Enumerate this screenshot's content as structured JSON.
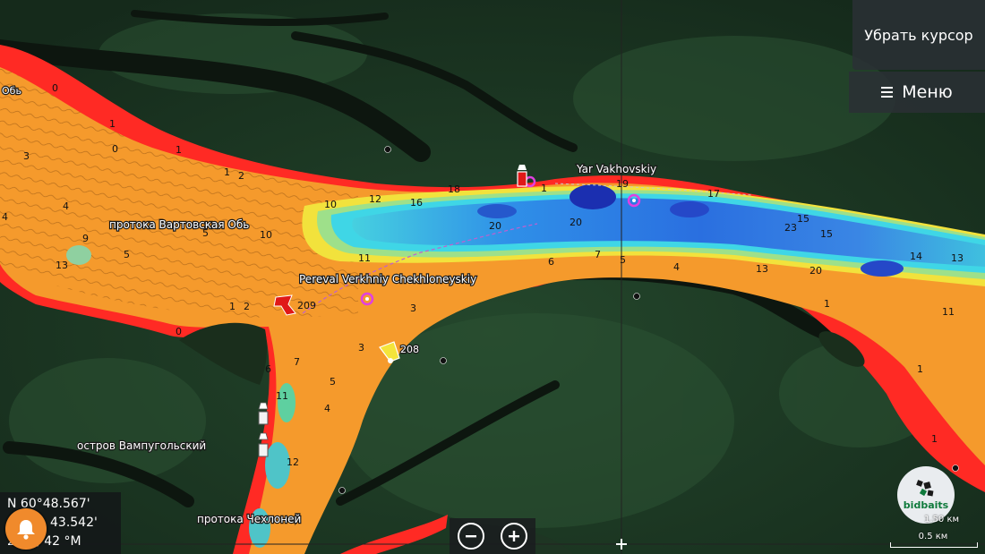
{
  "controls": {
    "remove_cursor": "Убрать курсор",
    "menu": "Меню"
  },
  "cursor_readout": {
    "lat": "N 60°48.567'",
    "lon": "43.542'",
    "info": "2 км, 42 °M"
  },
  "places": {
    "ob": "Обь",
    "vartovskaya": "протока Вартовская Обь",
    "pereval": "Pereval Verkhniy Chekhloneyskiy",
    "yar": "Yar Vakhovskiy",
    "vampugolskiy": "остров Вампугольский",
    "chekhloney": "протока Чехлоней"
  },
  "buoys": {
    "b209": "209",
    "b208": "208"
  },
  "depth_labels": [
    {
      "t": "0",
      "id": "d1"
    },
    {
      "t": "3",
      "id": "d2"
    },
    {
      "t": "4",
      "id": "d3"
    },
    {
      "t": "0",
      "id": "d4"
    },
    {
      "t": "1",
      "id": "d5"
    },
    {
      "t": "1",
      "id": "d6"
    },
    {
      "t": "2",
      "id": "d7"
    },
    {
      "t": "4",
      "id": "d8"
    },
    {
      "t": "5",
      "id": "d9"
    },
    {
      "t": "9",
      "id": "d10"
    },
    {
      "t": "5",
      "id": "d11"
    },
    {
      "t": "10",
      "id": "d12"
    },
    {
      "t": "12",
      "id": "d13"
    },
    {
      "t": "16",
      "id": "d14"
    },
    {
      "t": "10",
      "id": "d15"
    },
    {
      "t": "20",
      "id": "d16"
    },
    {
      "t": "20",
      "id": "d17"
    },
    {
      "t": "18",
      "id": "d18"
    },
    {
      "t": "19",
      "id": "d19"
    },
    {
      "t": "17",
      "id": "d20"
    },
    {
      "t": "15",
      "id": "d21"
    },
    {
      "t": "23",
      "id": "d22"
    },
    {
      "t": "15",
      "id": "d23"
    },
    {
      "t": "20",
      "id": "d24"
    },
    {
      "t": "13",
      "id": "d25"
    },
    {
      "t": "14",
      "id": "d26"
    },
    {
      "t": "13",
      "id": "d27"
    },
    {
      "t": "11",
      "id": "d28"
    },
    {
      "t": "11",
      "id": "d29"
    },
    {
      "t": "6",
      "id": "d30"
    },
    {
      "t": "7",
      "id": "d31"
    },
    {
      "t": "5",
      "id": "d32"
    },
    {
      "t": "4",
      "id": "d33"
    },
    {
      "t": "3",
      "id": "d34"
    },
    {
      "t": "1",
      "id": "d35"
    },
    {
      "t": "1",
      "id": "d36"
    },
    {
      "t": "0",
      "id": "d37"
    },
    {
      "t": "3",
      "id": "d38"
    },
    {
      "t": "6",
      "id": "d39"
    },
    {
      "t": "7",
      "id": "d40"
    },
    {
      "t": "5",
      "id": "d41"
    },
    {
      "t": "4",
      "id": "d42"
    },
    {
      "t": "11",
      "id": "d43"
    },
    {
      "t": "12",
      "id": "d44"
    },
    {
      "t": "1",
      "id": "d45"
    },
    {
      "t": "1",
      "id": "d46"
    },
    {
      "t": "1",
      "id": "d47"
    },
    {
      "t": "2",
      "id": "d48"
    },
    {
      "t": "13",
      "id": "d49"
    },
    {
      "t": "1",
      "id": "d50"
    }
  ],
  "scale": {
    "small": "1.50 км",
    "main": "0.5 км"
  },
  "logo": {
    "text": "bidbaits"
  },
  "colors": {
    "land": "#1d3a25",
    "shallow_red": "#ff2a24",
    "orange": "#f59a2c",
    "yellow": "#f2e23c",
    "cyan": "#3fd6e6",
    "blue": "#2c7de0",
    "deep": "#1b2fb0",
    "waypoint": "#e040e0",
    "bell": "#f08a2c"
  }
}
